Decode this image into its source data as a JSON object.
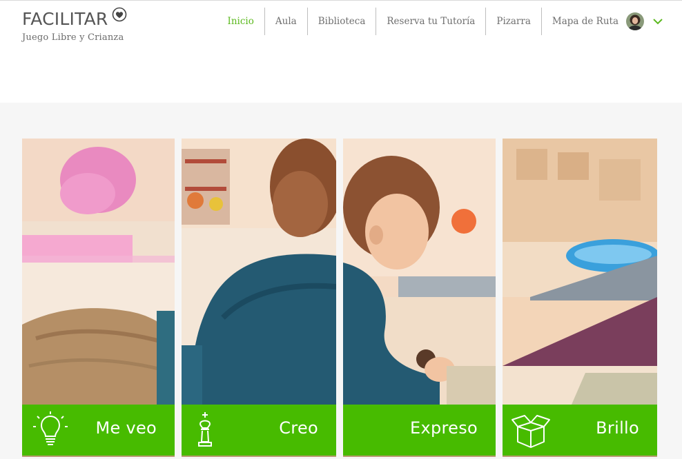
{
  "brand": {
    "title": "FACILITAR",
    "subtitle": "Juego Libre y Crianza",
    "icon": "heart-icon"
  },
  "nav": {
    "items": [
      {
        "label": "Inicio",
        "active": true
      },
      {
        "label": "Aula",
        "active": false
      },
      {
        "label": "Biblioteca",
        "active": false
      },
      {
        "label": "Reserva tu Tutoría",
        "active": false
      },
      {
        "label": "Pizarra",
        "active": false
      },
      {
        "label": "Mapa de Ruta",
        "active": false
      }
    ],
    "avatar_icon": "user-avatar",
    "dropdown_icon": "chevron-down-icon"
  },
  "tiles": [
    {
      "label": "Me veo",
      "icon": "lightbulb-icon"
    },
    {
      "label": "Creo",
      "icon": "chess-king-icon"
    },
    {
      "label": "Expreso",
      "icon": "none"
    },
    {
      "label": "Brillo",
      "icon": "open-box-icon"
    }
  ],
  "colors": {
    "accent": "#47bb00",
    "nav_active": "#5cb91f",
    "text": "#6f6f6f",
    "content_bg": "#f6f6f6"
  }
}
